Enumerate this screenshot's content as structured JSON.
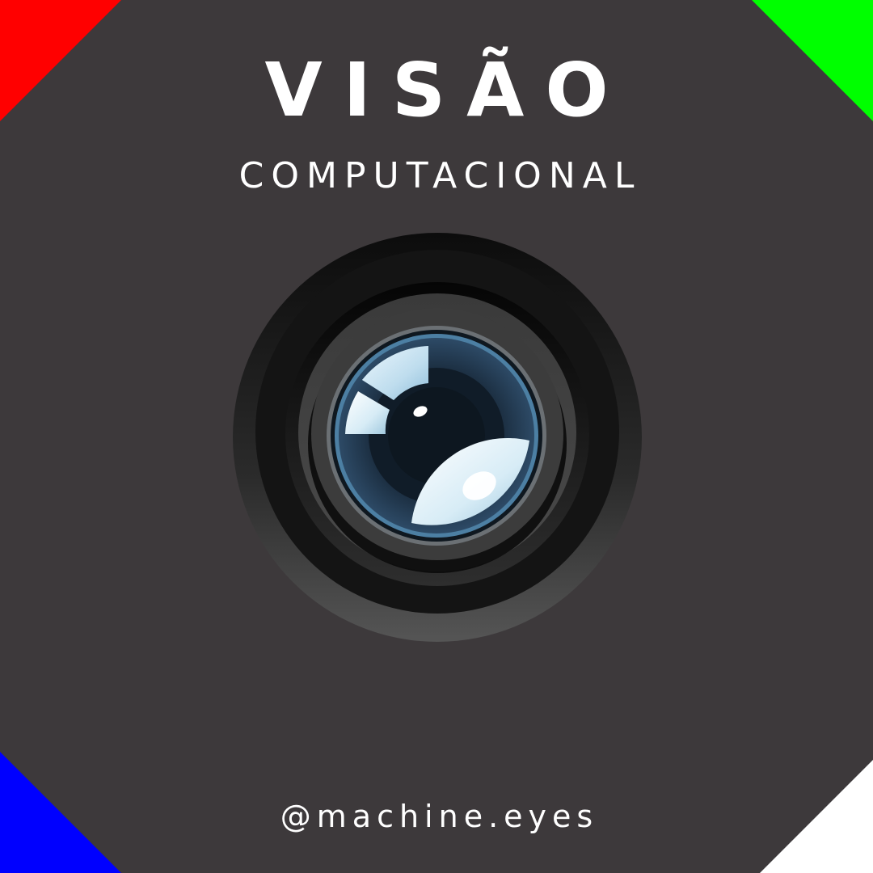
{
  "post": {
    "title": "VISÃO",
    "subtitle": "COMPUTACIONAL",
    "handle": "@machine.eyes"
  },
  "colors": {
    "background": "#3d393b",
    "corner_top_left": "#ff0000",
    "corner_top_right": "#00ff00",
    "corner_bottom_left": "#0000ff",
    "corner_bottom_right": "#ffffff",
    "text": "#ffffff"
  },
  "graphic": {
    "icon": "camera-lens"
  }
}
